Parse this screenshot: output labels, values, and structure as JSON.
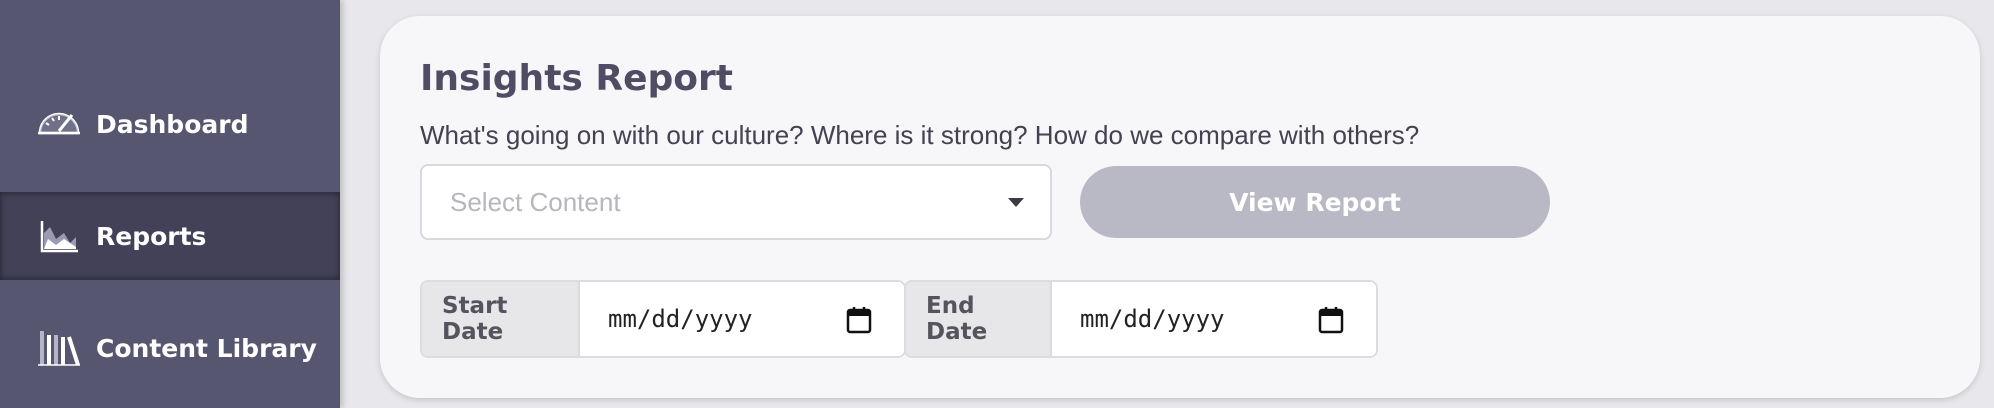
{
  "sidebar": {
    "items": [
      {
        "label": "Dashboard",
        "icon": "speedometer-icon",
        "active": false
      },
      {
        "label": "Reports",
        "icon": "area-chart-icon",
        "active": true
      },
      {
        "label": "Content Library",
        "icon": "books-icon",
        "active": false
      }
    ]
  },
  "main": {
    "title": "Insights Report",
    "subtitle": "What's going on with our culture? Where is it strong? How do we compare with others?",
    "select": {
      "placeholder": "Select Content"
    },
    "view_button": "View Report",
    "start_date": {
      "label": "Start Date",
      "placeholder": "mm/dd/yyyy"
    },
    "end_date": {
      "label": "End Date",
      "placeholder": "mm/dd/yyyy"
    }
  },
  "colors": {
    "sidebar": "#575670",
    "sidebar_active": "#424158",
    "button_disabled": "#b9b8c5",
    "title": "#4f4c63"
  }
}
